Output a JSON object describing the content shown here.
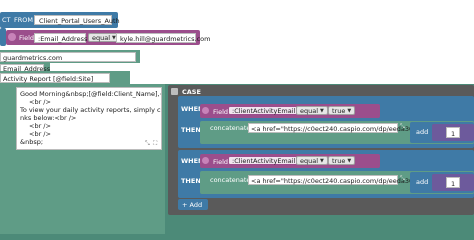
{
  "select_row": {
    "keyword_select": "CT",
    "keyword_from": "FROM",
    "table": "Client_Portal_Users_Auth"
  },
  "where_row": {
    "field_label": "Field",
    "field_value": ":Email_Address",
    "operator": "equal",
    "value": "kyle.hill@guardmetrics.com"
  },
  "rows": {
    "guard_value": "guardmetrics.com",
    "email_field": "Email_Address",
    "subject_text": "Activity Report [@field:Site]"
  },
  "body_text": {
    "line1": "Good Morning&nbsp;[@field:Client_Name],<br />",
    "line2": "<br />",
    "line3": "To view your daily activity reports, simply click the li",
    "line4": "nks below:<br />",
    "line5": "<br />",
    "line6": "<br />",
    "line7": "&nbsp;"
  },
  "case_block": {
    "label": "CASE",
    "add_label": "+ Add",
    "branches": [
      {
        "when_label": "WHEN",
        "then_label": "THEN",
        "field_label": "Field",
        "field_value": ":ClientActivityEmail",
        "operator": "equal",
        "bool_value": "true",
        "concat_label": "concatenate",
        "concat_value": "<a href=\"https://c0ect240.caspio.com/dp/eeda3000...",
        "add_label": "add",
        "num_value": "1"
      },
      {
        "when_label": "WHEN",
        "then_label": "THEN",
        "field_label": "Field",
        "field_value": ":ClientActivityEmail",
        "operator": "equal",
        "bool_value": "true",
        "concat_label": "concatenate",
        "concat_value": "<a href=\"https://c0ect240.caspio.com/dp/eeda3000...",
        "add_label": "add",
        "num_value": "1"
      }
    ]
  },
  "colors": {
    "sql_blue": "#3f7aa6",
    "field_purple": "#9b4e8c",
    "text_green": "#5f9c86",
    "case_grey": "#555555",
    "when_blue": "#3f7aa6"
  }
}
